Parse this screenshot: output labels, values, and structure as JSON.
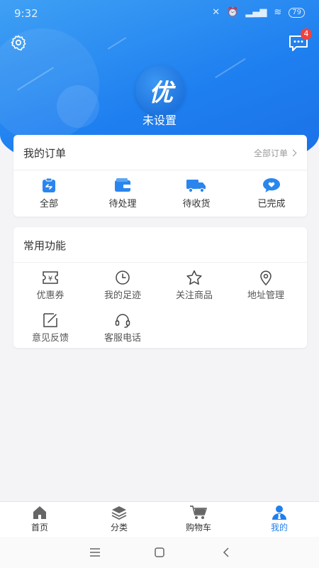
{
  "status_bar": {
    "time": "9:32",
    "battery": "79"
  },
  "header": {
    "username": "未设置",
    "avatar_text": "优",
    "message_badge": "4"
  },
  "orders": {
    "title": "我的订单",
    "all_link": "全部订单",
    "items": [
      {
        "label": "全部",
        "icon": "clipboard-icon"
      },
      {
        "label": "待处理",
        "icon": "wallet-icon"
      },
      {
        "label": "待收货",
        "icon": "truck-icon"
      },
      {
        "label": "已完成",
        "icon": "heart-chat-icon"
      }
    ]
  },
  "functions": {
    "title": "常用功能",
    "items": [
      {
        "label": "优惠券",
        "icon": "coupon-icon"
      },
      {
        "label": "我的足迹",
        "icon": "clock-icon"
      },
      {
        "label": "关注商品",
        "icon": "star-icon"
      },
      {
        "label": "地址管理",
        "icon": "location-icon"
      },
      {
        "label": "意见反馈",
        "icon": "edit-icon"
      },
      {
        "label": "客服电话",
        "icon": "headset-icon"
      }
    ]
  },
  "tabbar": {
    "items": [
      {
        "label": "首页",
        "icon": "home-icon"
      },
      {
        "label": "分类",
        "icon": "layers-icon"
      },
      {
        "label": "购物车",
        "icon": "cart-icon"
      },
      {
        "label": "我的",
        "icon": "user-icon",
        "active": true
      }
    ]
  },
  "colors": {
    "primary": "#1e7ff0",
    "badge": "#f0423c",
    "background": "#f4f4f6"
  }
}
